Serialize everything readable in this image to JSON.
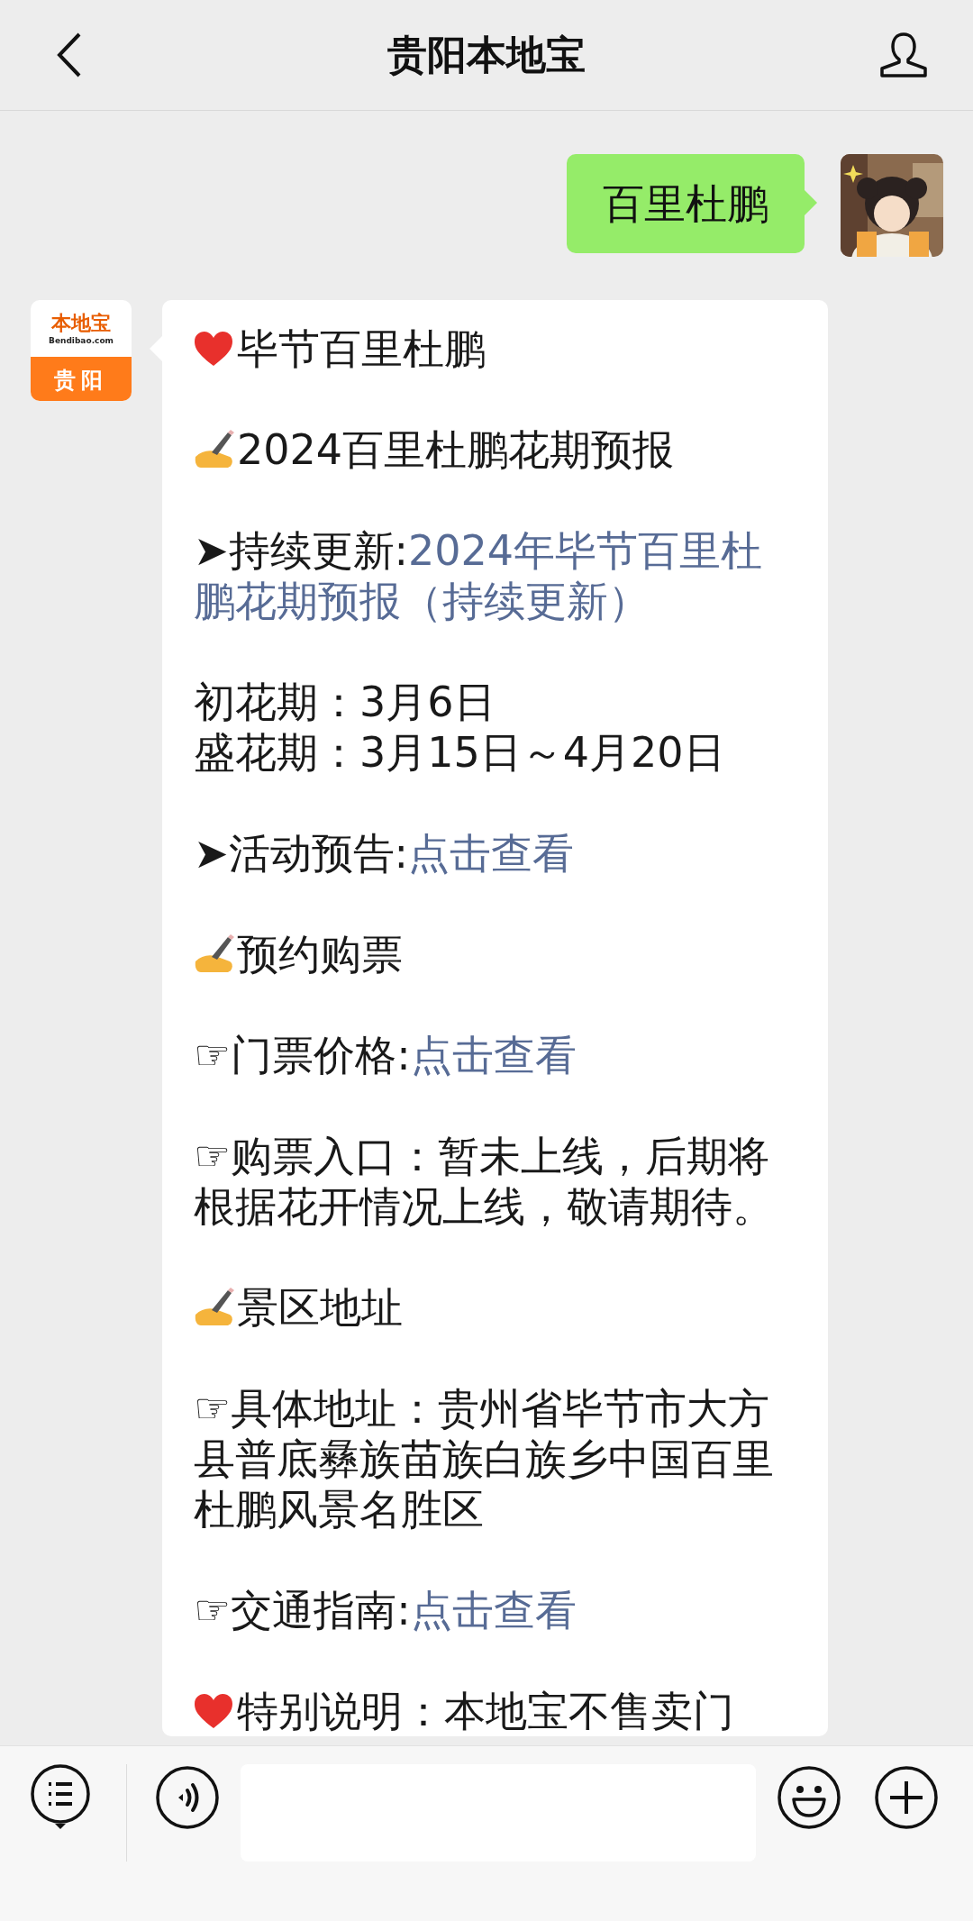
{
  "header": {
    "title": "贵阳本地宝"
  },
  "outgoing": {
    "text": "百里杜鹏"
  },
  "bot_logo": {
    "brand": "本地宝",
    "domain": "Bendibao.com",
    "city": "贵阳"
  },
  "message": [
    {
      "kind": "heart",
      "text": "毕节百里杜鹏"
    },
    {
      "kind": "hand",
      "text": "2024百里杜鹏花期预报"
    },
    {
      "kind": "link",
      "label": "➤持续更新:",
      "link": "2024年毕节百里杜鹏花期预报（持续更新）"
    },
    {
      "kind": "lines",
      "lines": [
        "初花期：3月6日",
        "盛花期：3月15日～4月20日"
      ]
    },
    {
      "kind": "link",
      "label": "➤活动预告:",
      "link": "点击查看"
    },
    {
      "kind": "hand",
      "text": "预约购票"
    },
    {
      "kind": "link",
      "label": "☞门票价格:",
      "link": "点击查看"
    },
    {
      "kind": "text",
      "text": "☞购票入口：暂未上线，后期将根据花开情况上线，敬请期待。"
    },
    {
      "kind": "hand",
      "text": "景区地址"
    },
    {
      "kind": "text",
      "text": "☞具体地址：贵州省毕节市大方县普底彝族苗族白族乡中国百里杜鹏风景名胜区"
    },
    {
      "kind": "link",
      "label": "☞交通指南:",
      "link": "点击查看"
    },
    {
      "kind": "heart",
      "text": "特别说明：本地宝不售卖门"
    }
  ]
}
